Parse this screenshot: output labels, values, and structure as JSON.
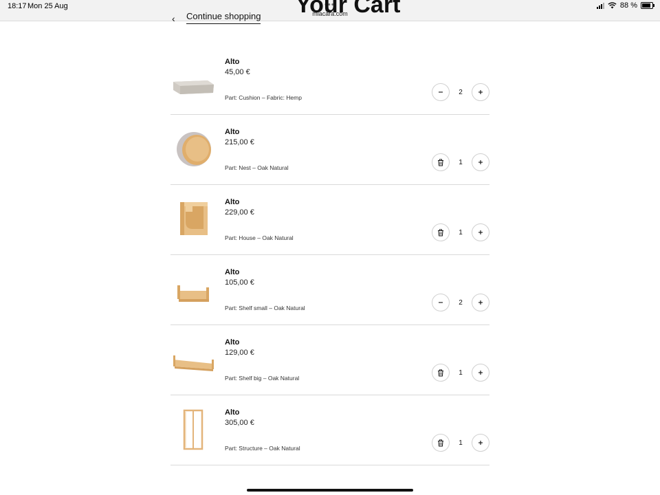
{
  "status_bar": {
    "time": "18:17",
    "date": "Mon 25 Aug",
    "url": "miacara.com",
    "battery": "88 %",
    "battery_level": 0.88
  },
  "header": {
    "back_link": "Continue shopping",
    "title": "Your Cart"
  },
  "cart": {
    "items": [
      {
        "name": "Alto",
        "price": "45,00 €",
        "part": "Part: Cushion – Fabric: Hemp",
        "quantity": "2",
        "left_action": "minus"
      },
      {
        "name": "Alto",
        "price": "215,00 €",
        "part": "Part: Nest – Oak Natural",
        "quantity": "1",
        "left_action": "delete"
      },
      {
        "name": "Alto",
        "price": "229,00 €",
        "part": "Part: House – Oak Natural",
        "quantity": "1",
        "left_action": "delete"
      },
      {
        "name": "Alto",
        "price": "105,00 €",
        "part": "Part: Shelf small – Oak Natural",
        "quantity": "2",
        "left_action": "minus"
      },
      {
        "name": "Alto",
        "price": "129,00 €",
        "part": "Part: Shelf big – Oak Natural",
        "quantity": "1",
        "left_action": "delete"
      },
      {
        "name": "Alto",
        "price": "305,00 €",
        "part": "Part: Structure – Oak Natural",
        "quantity": "1",
        "left_action": "delete"
      }
    ]
  },
  "colors": {
    "oak": "#e3b47a",
    "cushion": "#cfcac3",
    "divider": "#d9d9d9"
  }
}
